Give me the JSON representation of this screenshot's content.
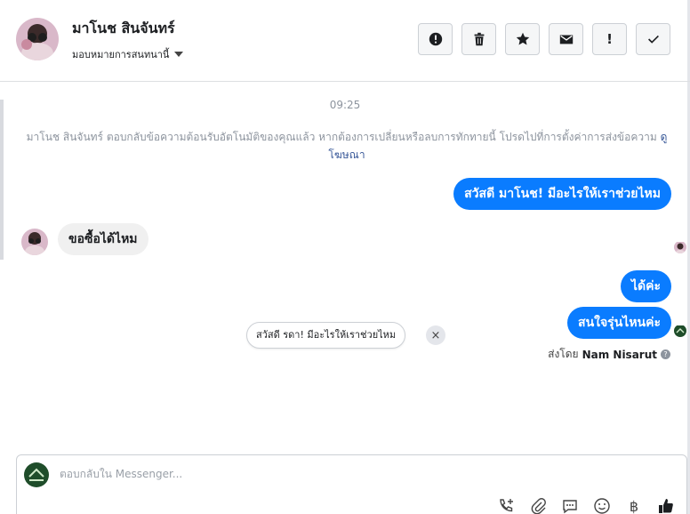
{
  "header": {
    "contact_name": "มาโนช สินจันทร์",
    "assign_label": "มอบหมายการสนทนานี้"
  },
  "toolbar": {
    "buttons": [
      {
        "icon": "alert-circle-icon"
      },
      {
        "icon": "trash-icon"
      },
      {
        "icon": "star-icon"
      },
      {
        "icon": "envelope-icon"
      },
      {
        "icon": "exclamation-icon",
        "glyph": "!"
      },
      {
        "icon": "check-icon"
      }
    ]
  },
  "thread": {
    "time": "09:25",
    "notice_text": "มาโนช สินจันทร์ ตอบกลับข้อความต้อนรับอัตโนมัติของคุณแล้ว หากต้องการเปลี่ยนหรือลบการทักทายนี้ โปรดไปที่การตั้งค่าการส่งข้อความ",
    "notice_link": "ดูโฆษณา",
    "messages": [
      {
        "side": "out",
        "text": "สวัสดี มาโนช! มีอะไรให้เราช่วยไหม"
      },
      {
        "side": "in",
        "text": "ขอซื้อได้ไหม"
      },
      {
        "side": "out",
        "text": "ได้ค่ะ"
      },
      {
        "side": "out",
        "text": "สนใจรุ่นไหนค่ะ"
      }
    ],
    "sent_by_label": "ส่งโดย",
    "sent_by_name": "Nam Nisarut",
    "help_glyph": "?",
    "suggestion": "สวัสดี รดา! มีอะไรให้เราช่วยไหม",
    "suggestion_close": "×"
  },
  "composer": {
    "placeholder": "ตอบกลับใน Messenger...",
    "currency_glyph": "฿"
  },
  "colors": {
    "outgoing_bubble": "#0a7cff",
    "incoming_bubble": "#f0f0f0",
    "link": "#385898"
  }
}
